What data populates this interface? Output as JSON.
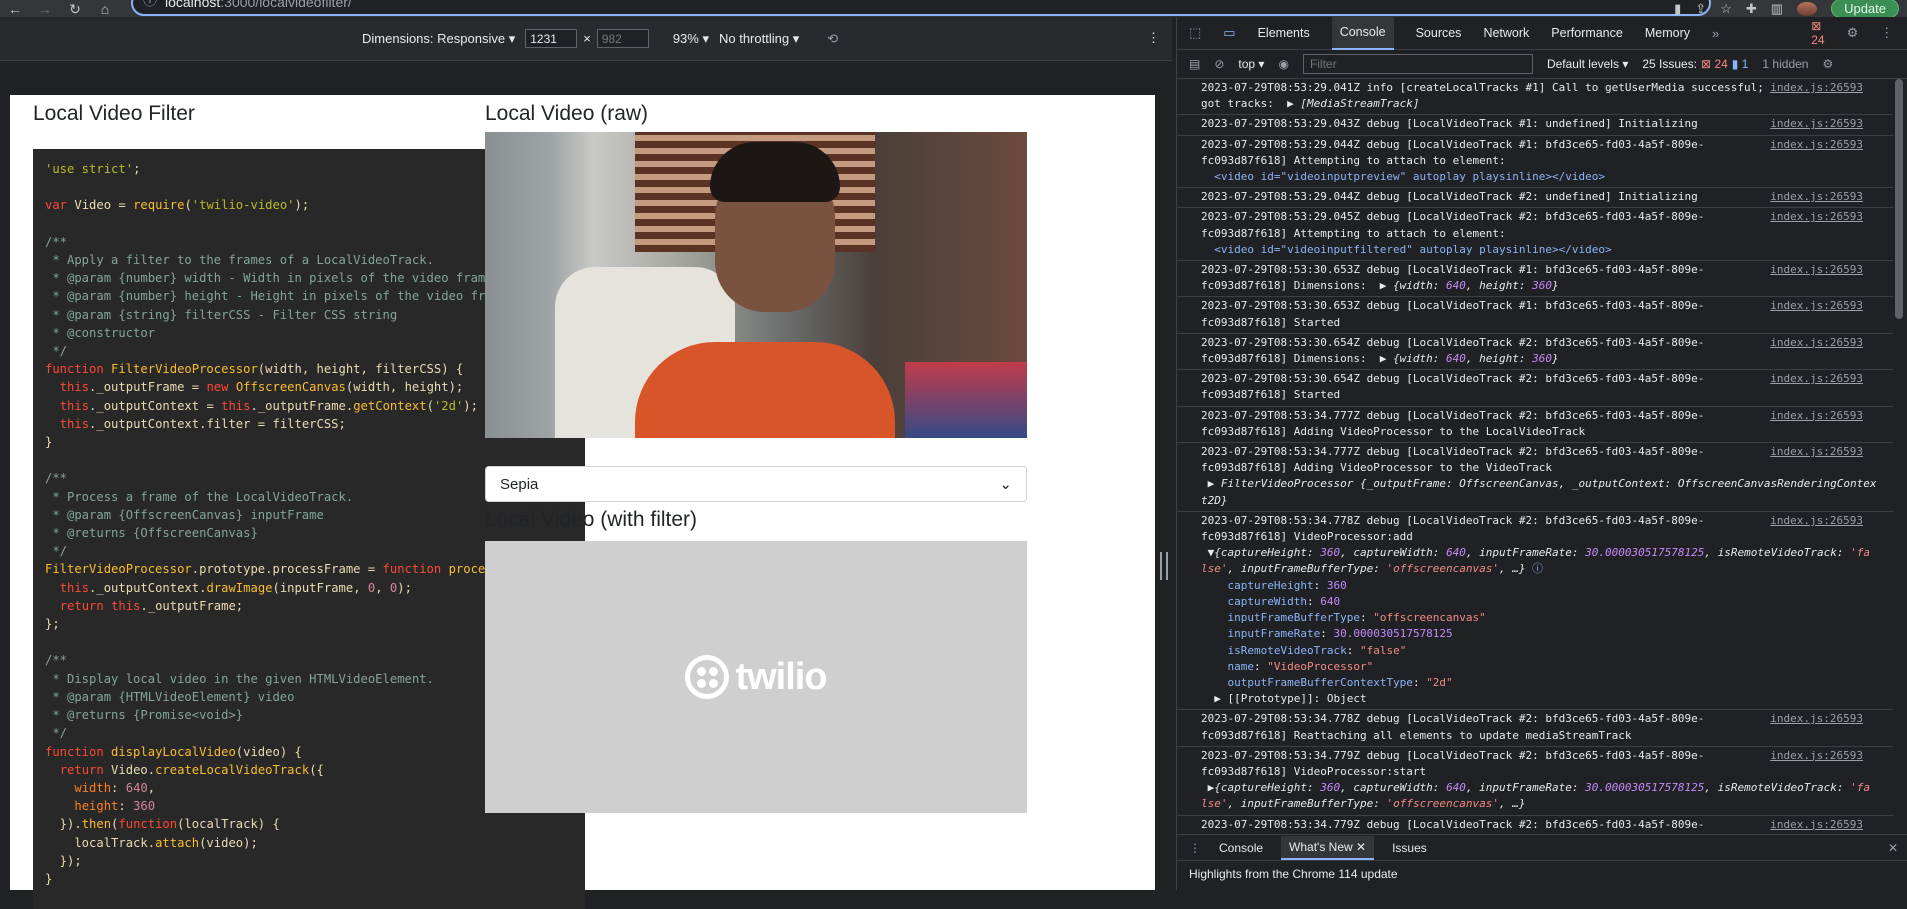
{
  "browser": {
    "url_host": "localhost",
    "url_path": ":3000/localvideofilter/",
    "update_label": "Update",
    "error_count": "24"
  },
  "devtoolbar": {
    "dimensions_label": "Dimensions: Responsive",
    "width": "1231",
    "height_placeholder": "982",
    "zoom": "93%",
    "throttling": "No throttling"
  },
  "page": {
    "heading_left": "Local Video Filter",
    "heading_raw": "Local Video (raw)",
    "heading_filtered": "Local Video (with filter)",
    "filter_selected": "Sepia",
    "logo_text": "twilio"
  },
  "devtools": {
    "tabs": [
      "Elements",
      "Console",
      "Sources",
      "Network",
      "Performance",
      "Memory"
    ],
    "active_tab": "Console",
    "context": "top",
    "filter_placeholder": "Filter",
    "levels": "Default levels",
    "issues_label": "25 Issues:",
    "issues_err": "24",
    "issues_info": "1",
    "hidden": "1 hidden",
    "error_badge": "24",
    "drawer_tabs": [
      "Console",
      "What's New",
      "Issues"
    ],
    "drawer_body": "Highlights from the Chrome 114 update",
    "source": "index.js:26593"
  }
}
